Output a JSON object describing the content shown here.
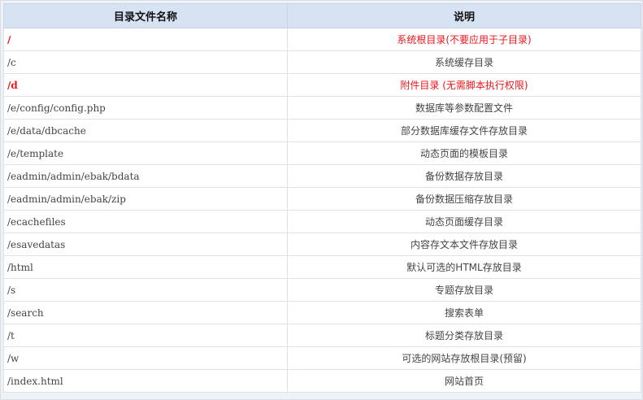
{
  "table": {
    "headers": {
      "name": "目录文件名称",
      "desc": "说明"
    },
    "accent_color": "#e8161b",
    "header_bg": "#d7e3f3",
    "rows": [
      {
        "path": "/",
        "desc": "系统根目录(不要应用于子目录)",
        "highlight": true
      },
      {
        "path": "/c",
        "desc": "系统缓存目录",
        "highlight": false
      },
      {
        "path": "/d",
        "desc": "附件目录 (无需脚本执行权限)",
        "highlight": true
      },
      {
        "path": "/e/config/config.php",
        "desc": "数据库等参数配置文件",
        "highlight": false
      },
      {
        "path": "/e/data/dbcache",
        "desc": "部分数据库缓存文件存放目录",
        "highlight": false
      },
      {
        "path": "/e/template",
        "desc": "动态页面的模板目录",
        "highlight": false
      },
      {
        "path": "/eadmin/admin/ebak/bdata",
        "desc": "备份数据存放目录",
        "highlight": false
      },
      {
        "path": "/eadmin/admin/ebak/zip",
        "desc": "备份数据压缩存放目录",
        "highlight": false
      },
      {
        "path": "/ecachefiles",
        "desc": "动态页面缓存目录",
        "highlight": false
      },
      {
        "path": "/esavedatas",
        "desc": "内容存文本文件存放目录",
        "highlight": false
      },
      {
        "path": "/html",
        "desc": "默认可选的HTML存放目录",
        "highlight": false
      },
      {
        "path": "/s",
        "desc": "专题存放目录",
        "highlight": false
      },
      {
        "path": "/search",
        "desc": "搜索表单",
        "highlight": false
      },
      {
        "path": "/t",
        "desc": "标题分类存放目录",
        "highlight": false
      },
      {
        "path": "/w",
        "desc": "可选的网站存放根目录(预留)",
        "highlight": false
      },
      {
        "path": "/index.html",
        "desc": "网站首页",
        "highlight": false
      }
    ]
  }
}
